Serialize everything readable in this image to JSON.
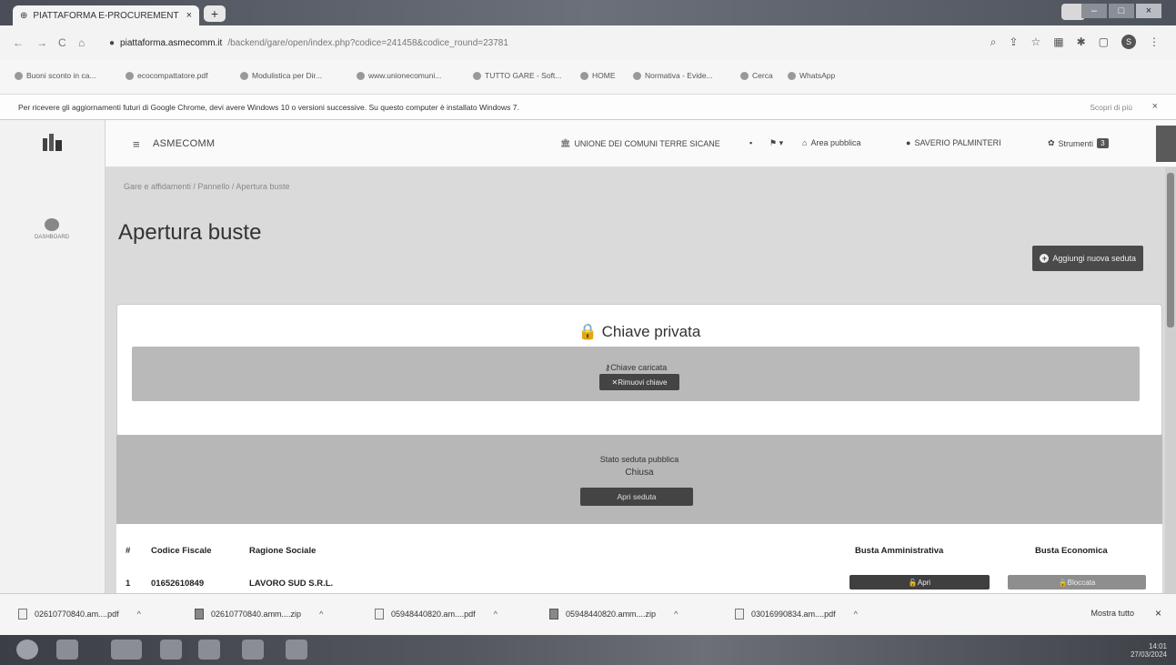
{
  "browser": {
    "tab_title": "PIATTAFORMA E-PROCUREMENT",
    "tab_close": "×",
    "new_tab": "+",
    "url_host": "piattaforma.asmecomm.it",
    "url_path": "/backend/gare/open/index.php?codice=241458&codice_round=23781",
    "nav_back": "←",
    "nav_forward": "→",
    "nav_reload": "C",
    "nav_home": "⌂",
    "bookmarks": [
      "Buoni sconto in ca...",
      "ecocompattatore.pdf",
      "Modulistica per Dir...",
      "www.unionecomuni...",
      "TUTTO GARE - Soft...",
      "HOME",
      "Normativa - Evide...",
      "Cerca",
      "WhatsApp"
    ],
    "info_message": "Per ricevere gli aggiornamenti futuri di Google Chrome, devi avere Windows 10 o versioni successive. Su questo computer è installato Windows 7.",
    "info_more": "Scopri di più",
    "info_close": "×",
    "profile_initial": "S"
  },
  "sidebar": {
    "dashboard_label": "DASHBOARD"
  },
  "topbar": {
    "menu_icon": "≡",
    "brand": "ASMECOMM",
    "union": "UNIONE DEI COMUNI TERRE SICANE",
    "area": "Area pubblica",
    "user": "SAVERIO PALMINTERI",
    "tools": "Strumenti",
    "tools_badge": "3"
  },
  "page": {
    "breadcrumb": "Gare e affidamenti  /  Pannello  /  Apertura buste",
    "title": "Apertura buste",
    "add_session": "Aggiungi nuova seduta"
  },
  "private_key": {
    "title": "Chiave privata",
    "status": "Chiave caricata",
    "remove_button": "Rimuovi chiave"
  },
  "session": {
    "status_label": "Stato seduta pubblica",
    "status_value": "Chiusa",
    "open_button": "Apri seduta"
  },
  "table": {
    "headers": [
      "#",
      "Codice Fiscale",
      "Ragione Sociale",
      "Busta Amministrativa",
      "Busta Economica"
    ],
    "rows": [
      {
        "n": "1",
        "cf": "01652610849",
        "ragione": "LAVORO SUD S.R.L.",
        "amm": "Apri",
        "eco": "Bloccata"
      }
    ]
  },
  "downloads": {
    "items": [
      {
        "name": "02610770840.am....pdf",
        "type": "pdf"
      },
      {
        "name": "02610770840.amm....zip",
        "type": "zip"
      },
      {
        "name": "05948440820.am....pdf",
        "type": "pdf"
      },
      {
        "name": "05948440820.amm....zip",
        "type": "zip"
      },
      {
        "name": "03016990834.am....pdf",
        "type": "pdf"
      }
    ],
    "show_all": "Mostra tutto",
    "close": "×"
  },
  "taskbar": {
    "time": "14:01",
    "date": "27/03/2024"
  }
}
